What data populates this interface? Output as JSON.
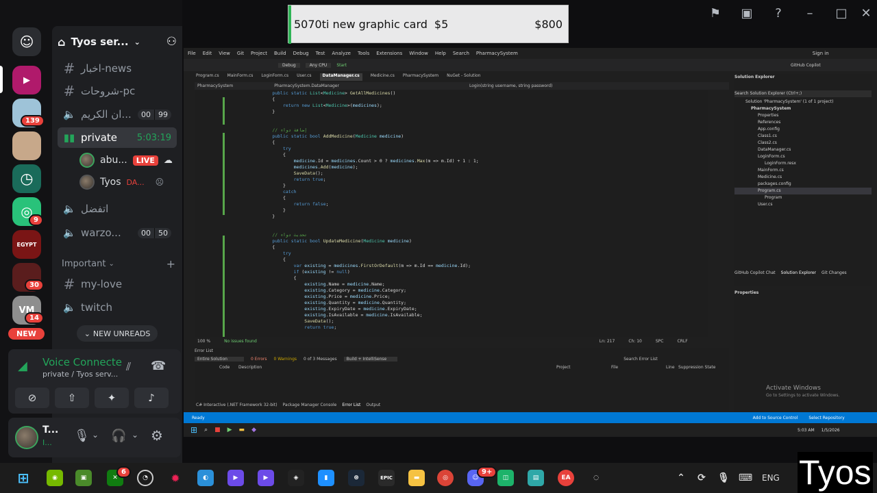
{
  "banner": {
    "item": "5070ti new graphic card",
    "price_small": "$5",
    "price_big": "$800"
  },
  "discord": {
    "server_name": "Tyos ser...",
    "rail_badges": [
      "139",
      "9",
      "30",
      "14"
    ],
    "new_label": "NEW",
    "channels": [
      {
        "name": "اخبار-news",
        "type": "text"
      },
      {
        "name": "شروحات-pc",
        "type": "text"
      },
      {
        "name": "ان الكريم...",
        "type": "voice",
        "count_a": "00",
        "count_b": "99"
      },
      {
        "name": "private",
        "type": "voice",
        "timer": "5:03:19"
      }
    ],
    "voice_users": [
      {
        "name": "abu...",
        "live": "LIVE"
      },
      {
        "name": "Tyos",
        "status": "DA..."
      }
    ],
    "channels2": [
      {
        "name": "اتفضل",
        "type": "voice"
      },
      {
        "name": "warzo...",
        "type": "voice",
        "count_a": "00",
        "count_b": "50"
      }
    ],
    "category": "Important",
    "channels3": [
      {
        "name": "my-love",
        "type": "text"
      },
      {
        "name": "twitch",
        "type": "voice"
      }
    ],
    "new_unreads": "NEW UNREADS",
    "voice_connected": "Voice Connecte",
    "voice_sub": "private / Tyos serv...",
    "user_name": "T...",
    "user_sub": "I..."
  },
  "vs": {
    "menu": [
      "File",
      "Edit",
      "View",
      "Git",
      "Project",
      "Build",
      "Debug",
      "Test",
      "Analyze",
      "Tools",
      "Extensions",
      "Window",
      "Help",
      "Search",
      "PharmacySystem"
    ],
    "signin": "Sign in",
    "copilot": "GitHub Copilot",
    "toolbar": [
      "Debug",
      "Any CPU",
      "Start"
    ],
    "tabs": [
      "Program.cs",
      "MainForm.cs",
      "LoginForm.cs",
      "User.cs",
      "DataManager.cs",
      "Medicine.cs",
      "PharmacySystem",
      "NuGet - Solution"
    ],
    "nav_left": "PharmacySystem",
    "nav_mid": "PharmacySystem.DataManager",
    "nav_right": "Login(string username, string password)",
    "status_zoom": "100 %",
    "status_issues": "No issues found",
    "status_ln": "Ln: 217",
    "status_ch": "Ch: 10",
    "status_spc": "SPC",
    "status_crlf": "CRLF",
    "solution_title": "Solution Explorer",
    "solution_search": "Search Solution Explorer (Ctrl+;)",
    "solution_items": [
      "Solution 'PharmacySystem' (1 of 1 project)",
      "PharmacySystem",
      "Properties",
      "References",
      "App.config",
      "Class1.cs",
      "Class2.cs",
      "DataManager.cs",
      "LoginForm.cs",
      "LoginForm.resx",
      "MainForm.cs",
      "Medicine.cs",
      "packages.config",
      "Program.cs",
      "Program",
      "User.cs"
    ],
    "sol_tabs": [
      "GitHub Copilot Chat",
      "Solution Explorer",
      "Git Changes"
    ],
    "properties_title": "Properties",
    "error_title": "Error List",
    "error_scope": "Entire Solution",
    "errors": "0 Errors",
    "warnings": "0 Warnings",
    "messages": "0 of 3 Messages",
    "build_filter": "Build + IntelliSense",
    "search_errors": "Search Error List",
    "err_cols": [
      "Code",
      "Description",
      "Project",
      "File",
      "Line",
      "Suppression State"
    ],
    "bottom_tabs": [
      "C# Interactive (.NET Framework 32-bit)",
      "Package Manager Console",
      "Error List",
      "Output"
    ],
    "ready": "Ready",
    "add_source": "Add to Source Control",
    "select_repo": "Select Repository",
    "activate": "Activate Windows",
    "activate_sub": "Go to Settings to activate Windows.",
    "clock_time": "5:03 AM",
    "clock_date": "1/5/2026"
  },
  "taskbar": {
    "lang": "ENG",
    "badge_xbox": "6",
    "badge_discord": "9+"
  },
  "watermark": "Tyos"
}
